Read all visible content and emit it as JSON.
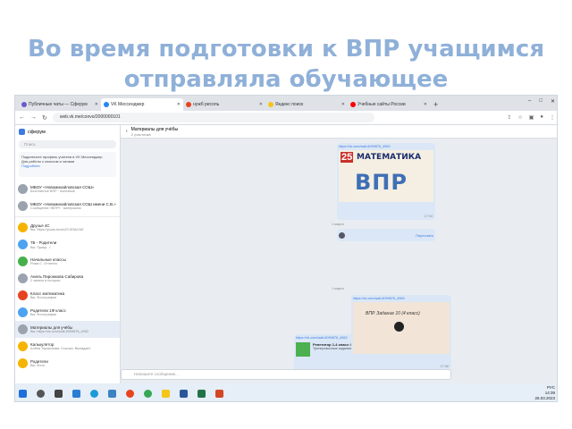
{
  "slide": {
    "title": "Во время подготовки к ВПР учащимся отправляла обучающее"
  },
  "browser": {
    "tabs": [
      {
        "label": "Публичные чаты — Сферум",
        "color": "#6a5acd"
      },
      {
        "label": "VK Мессенджер",
        "color": "#2787f5",
        "active": true
      },
      {
        "label": "нужб ресоль",
        "color": "#e8431f"
      },
      {
        "label": "Яндекс поиск",
        "color": "#f5c518"
      },
      {
        "label": "Учебные сайты России",
        "color": "#ff0000"
      }
    ],
    "url": "web.vk.me/convo/2000000101",
    "new_tab": "+",
    "window_controls": [
      "–",
      "□",
      "✕"
    ]
  },
  "sidebar": {
    "app_name": "сферум",
    "search_placeholder": "Поиск",
    "notice": {
      "text": "Подключите профиль учителя в VK Мессенджер",
      "sub": "Для работы с классом и чатами",
      "link": "Подробнее"
    },
    "chats": [
      {
        "name": "МБОУ «Новомихайловская СОШ»",
        "preview": "Бесплатное ВПР · полезные",
        "color": "#9aa3ae"
      },
      {
        "name": "МБОУ «Новомихайловская СОШ имени С.В.»",
        "preview": "Сообщение «ВПР» · материалы",
        "color": "#9aa3ae"
      },
      {
        "name": "Друзья 4С",
        "preview": "Вы: https://youtu.be/ahZYJEMvOrE",
        "color": "#f5b400"
      },
      {
        "name": "7Б - Родители",
        "preview": "Вы: Прикр. ✓",
        "color": "#4da3f0"
      },
      {
        "name": "Начальные классы",
        "preview": "Рома С. Отлично",
        "color": "#47b04b"
      },
      {
        "name": "Анель Пирожкова Сабирова",
        "preview": "2 записи в истории",
        "color": "#9aa3ae"
      },
      {
        "name": "Класс математика",
        "preview": "Вы: Фотографии",
        "color": "#e8431f"
      },
      {
        "name": "Родители 1Ф класс",
        "preview": "Вы: Фотографии",
        "color": "#4da3f0"
      },
      {
        "name": "Материалы для учёбы",
        "preview": "Вы: https://vk.com/wall-6099876_4952",
        "color": "#9aa3ae",
        "selected": true
      },
      {
        "name": "Калькулятор",
        "preview": "Алёна Тирфонова: Ссылка. Выпадает",
        "color": "#f5b400"
      },
      {
        "name": "Родители",
        "preview": "Вы: Фото",
        "color": "#f5b400"
      }
    ]
  },
  "chat": {
    "title": "Материалы для учёбы",
    "subtitle": "2 участника",
    "messages": [
      {
        "link": "https://vk.com/wall-6099876_4952",
        "card_num": "25",
        "card_word": "МАТЕМАТИКА",
        "card_big": "ВПР",
        "time": "17:04"
      },
      {
        "date": "1 марта"
      },
      {
        "text": "Переслать",
        "time": "17:04"
      },
      {
        "link": "https://vk.com/wall-6099876_4962",
        "title": "Репетитор 1-4 класс: ВПР по окружающему миру 4 класса",
        "desc": "Тренировочные задания к ВПР по окружающему миру",
        "time": "17:05"
      },
      {
        "date": "1 марта"
      },
      {
        "link": "https://vk.com/wall-6099876_4969",
        "card_text": "ВПР. Задание 10 (4 класс)",
        "time": "17:06"
      }
    ],
    "input_placeholder": "Напишите сообщение..."
  },
  "taskbar": {
    "icons": [
      {
        "name": "start",
        "color": "#1e6fd9"
      },
      {
        "name": "search",
        "color": "#555555"
      },
      {
        "name": "task-view",
        "color": "#444444"
      },
      {
        "name": "mail",
        "color": "#2b7cd3"
      },
      {
        "name": "edge",
        "color": "#1c9bd8"
      },
      {
        "name": "store",
        "color": "#3b82c4"
      },
      {
        "name": "yandex",
        "color": "#e8431f"
      },
      {
        "name": "chrome",
        "color": "#34a853"
      },
      {
        "name": "explorer",
        "color": "#f5c518"
      },
      {
        "name": "word",
        "color": "#2b579a"
      },
      {
        "name": "excel",
        "color": "#217346"
      },
      {
        "name": "powerpoint",
        "color": "#d24726"
      }
    ],
    "time": "14:39",
    "date": "26.03.2023",
    "lang": "РУС"
  }
}
